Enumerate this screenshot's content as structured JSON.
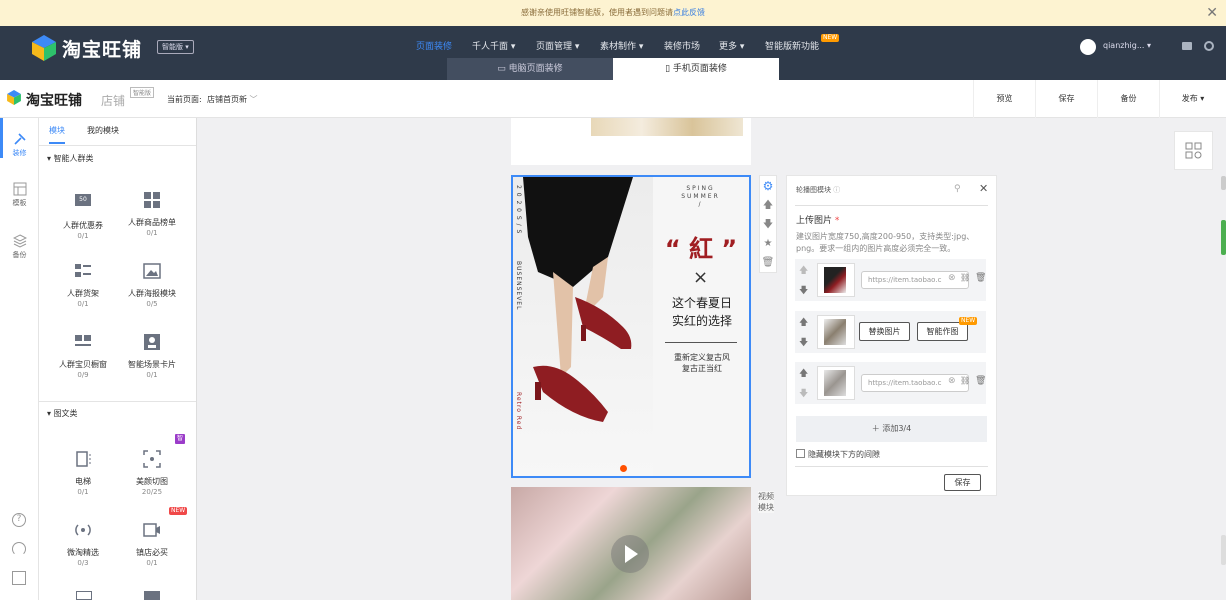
{
  "notice": {
    "text": "感谢亲使用旺铺智能版，使用者遇到问题请",
    "link": "点此反馈"
  },
  "brand": {
    "name": "淘宝旺铺",
    "edition": "智能版"
  },
  "nav": {
    "items": [
      "页面装修",
      "千人千面",
      "页面管理",
      "素材制作",
      "装修市场",
      "更多",
      "智能版新功能"
    ],
    "new_badge": "NEW",
    "user": "qianzhig..."
  },
  "subtabs": [
    "电脑页面装修",
    "手机页面装修"
  ],
  "toolbar": {
    "brand": "淘宝旺铺",
    "shop": "店铺",
    "edition": "智能版",
    "current_label": "当前页面:",
    "current_value": "店铺首页新",
    "buttons": [
      "预览",
      "保存",
      "备份",
      "发布"
    ]
  },
  "rail": [
    "装修",
    "模板",
    "备份"
  ],
  "library": {
    "tabs": [
      "模块",
      "我的模块"
    ],
    "cat1": "智能人群类",
    "mods1": [
      {
        "label": "人群优惠券",
        "count": "0/1",
        "icon": "coupon-icon"
      },
      {
        "label": "人群商品榜单",
        "count": "0/1",
        "icon": "grid-icon"
      },
      {
        "label": "人群货架",
        "count": "0/1",
        "icon": "shelf-icon"
      },
      {
        "label": "人群海报模块",
        "count": "0/5",
        "icon": "image-icon"
      },
      {
        "label": "人群宝贝橱窗",
        "count": "0/9",
        "icon": "window-icon"
      },
      {
        "label": "智能场景卡片",
        "count": "0/1",
        "icon": "card-icon"
      }
    ],
    "coupon_text": "50",
    "cat2": "图文类",
    "mods2": [
      {
        "label": "电梯",
        "count": "0/1",
        "icon": "elevator-icon"
      },
      {
        "label": "美颜切图",
        "count": "20/25",
        "icon": "crop-icon"
      },
      {
        "label": "微淘精选",
        "count": "0/3",
        "icon": "broadcast-icon"
      },
      {
        "label": "镇店必买",
        "count": "0/1",
        "icon": "video-icon"
      }
    ],
    "badge_smart": "智",
    "badge_new": "NEW"
  },
  "banner": {
    "vert_left": "2 0 2 0  S / S",
    "vert_mid": "BUSENSEVEL",
    "vert_bottom": "Retro Red",
    "season": "SPING\nSUMMER\n/",
    "big": "紅",
    "line1": "这个春夏日",
    "line2": "实红的选择",
    "sub1": "重新定义复古风",
    "sub2": "复古正当红"
  },
  "video_label": "视频模块",
  "panel": {
    "title": "轮播图模块",
    "upload_label": "上传图片",
    "hint": "建议图片宽度750,高度200-950，支持类型:jpg、png。要求一组内的图片高度必须完全一致。",
    "url_placeholder": "https://item.taobao.c",
    "replace": "替换图片",
    "smart": "智能作图",
    "new": "NEW",
    "add": "添加3/4",
    "hide_gap": "隐藏模块下方的间隙",
    "save": "保存"
  },
  "colors": {
    "accent": "#3d8af7",
    "nav_bg": "#2f3a4a",
    "banner_red": "#a01e22"
  }
}
